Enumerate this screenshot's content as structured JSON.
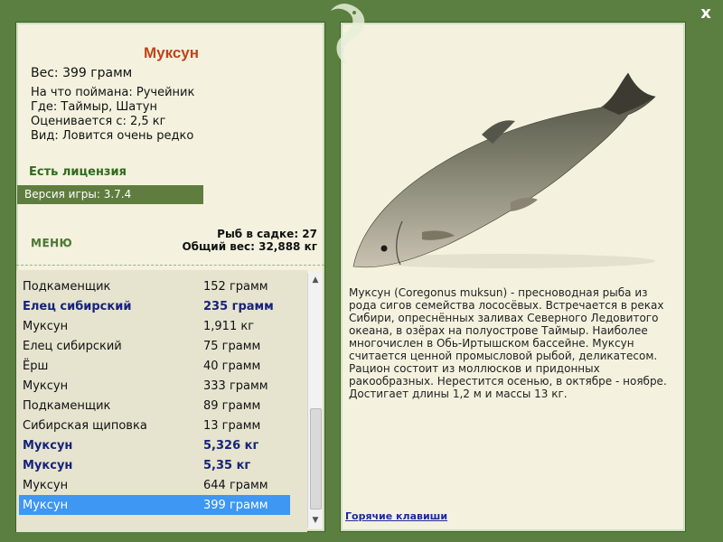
{
  "fish": {
    "title": "Муксун",
    "weight": "Вес: 399 грамм",
    "bait": "На что поймана: Ручейник",
    "location": "Где: Таймыр, Шатун",
    "value_from": "Оценивается с: 2,5 кг",
    "rarity": "Вид: Ловится очень редко",
    "description": "Муксун (Coregonus muksun) - пресноводная рыба из рода сигов семейства лососёвых. Встречается в реках Сибири, опреснённых заливах Северного Ледовитого океана, в озёрах на полуострове Таймыр. Наиболее многочислен в Обь-Иртышском бассейне. Муксун считается ценной промысловой рыбой, деликатесом. Рацион состоит из моллюсков и придонных ракообразных. Нерестится осенью, в октябре - ноябре. Достигает длины 1,2 м и массы 13 кг."
  },
  "license": "Есть лицензия",
  "version": "Версия игры: 3.7.4",
  "menu_label": "МЕНЮ",
  "stats": {
    "count": "Рыб в садке: 27",
    "total": "Общий вес: 32,888 кг"
  },
  "catches": [
    {
      "name": "Подкаменщик",
      "weight": "152 грамм",
      "bold": false,
      "selected": false
    },
    {
      "name": "Елец сибирский",
      "weight": "235 грамм",
      "bold": true,
      "selected": false
    },
    {
      "name": "Муксун",
      "weight": "1,911 кг",
      "bold": false,
      "selected": false
    },
    {
      "name": "Елец сибирский",
      "weight": "75 грамм",
      "bold": false,
      "selected": false
    },
    {
      "name": "Ёрш",
      "weight": "40 грамм",
      "bold": false,
      "selected": false
    },
    {
      "name": "Муксун",
      "weight": "333 грамм",
      "bold": false,
      "selected": false
    },
    {
      "name": "Подкаменщик",
      "weight": "89 грамм",
      "bold": false,
      "selected": false
    },
    {
      "name": "Сибирская щиповка",
      "weight": "13 грамм",
      "bold": false,
      "selected": false
    },
    {
      "name": "Муксун",
      "weight": "5,326 кг",
      "bold": true,
      "selected": false
    },
    {
      "name": "Муксун",
      "weight": "5,35 кг",
      "bold": true,
      "selected": false
    },
    {
      "name": "Муксун",
      "weight": "644 грамм",
      "bold": false,
      "selected": false
    },
    {
      "name": "Муксун",
      "weight": "399 грамм",
      "bold": false,
      "selected": true
    }
  ],
  "hotkeys": "Горячие клавиши",
  "close": "x",
  "icons": {
    "logo": "fish-logo-icon",
    "close": "close-icon"
  },
  "colors": {
    "frame": "#5a7f40",
    "panel": "#f4f2df",
    "title": "#c0441a",
    "selected": "#3d97f3"
  }
}
